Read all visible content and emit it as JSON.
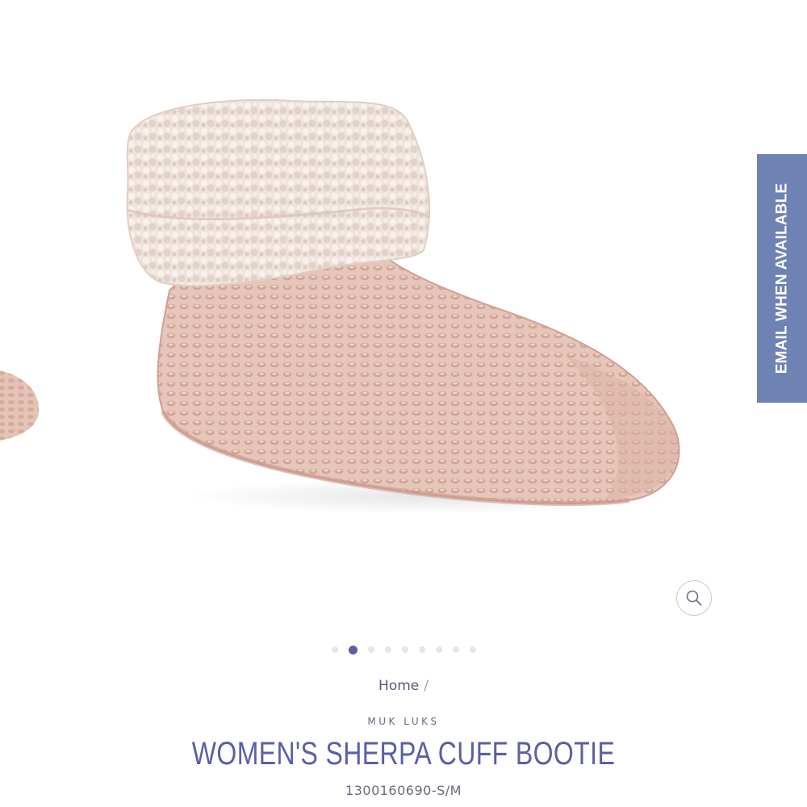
{
  "product": {
    "image_alt": "Women's Sherpa Cuff Bootie in pink knit with cream sherpa cuff",
    "brand": "MUK LUKS",
    "title": "WOMEN'S SHERPA CUFF BOOTIE",
    "sku": "1300160690-S/M"
  },
  "gallery": {
    "slide_count": 9,
    "active_slide": 2,
    "zoom_icon": "magnifier-icon"
  },
  "breadcrumb": {
    "home_label": "Home",
    "separator": "/"
  },
  "email_tab": {
    "label": "EMAIL WHEN AVAILABLE"
  },
  "colors": {
    "accent": "#5b5fa6",
    "email_tab_bg": "#6f82b4",
    "knit_pink": "#e4c2b6",
    "sherpa_cream": "#efe3dc"
  }
}
